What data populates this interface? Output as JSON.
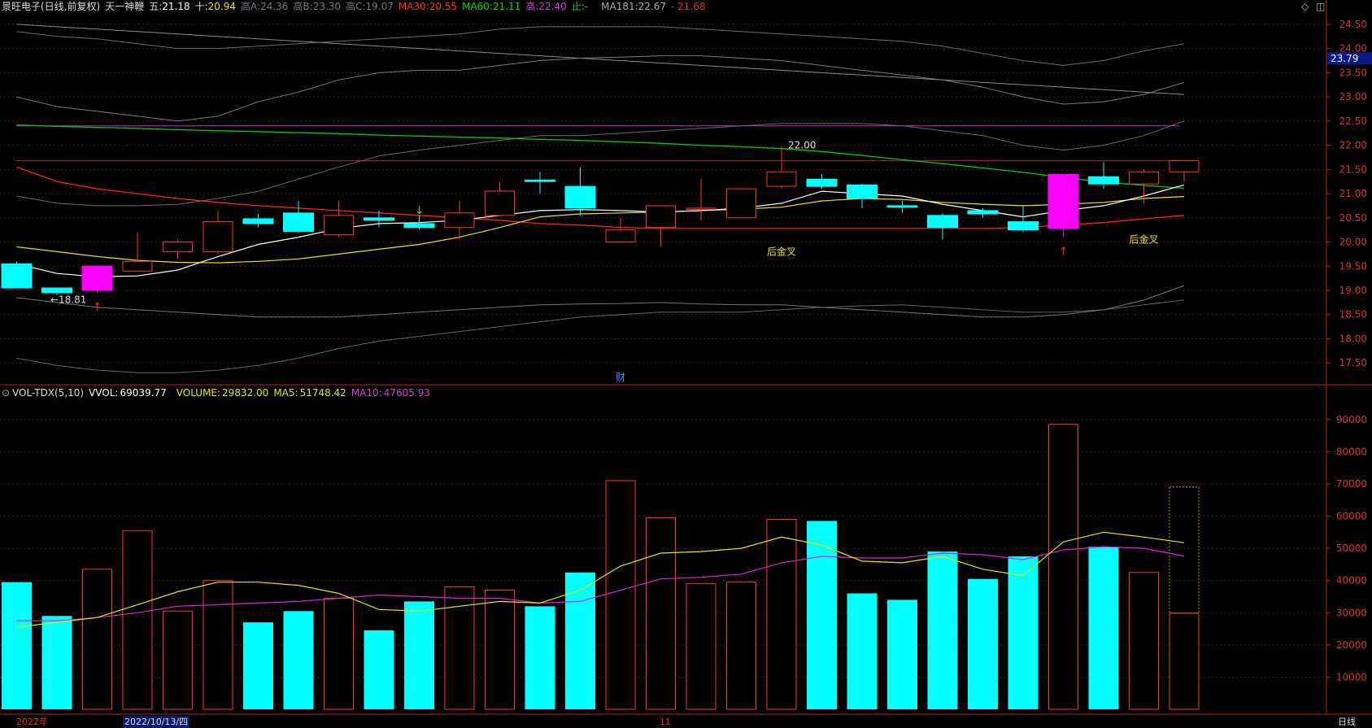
{
  "header": {
    "stock": "景旺电子(日线,前复权)",
    "indicator": "天一神鞭",
    "wu_label": "五:",
    "wu_val": "21.18",
    "shi_label": "十:",
    "shi_val": "20.94",
    "gaoA_label": "高A:",
    "gaoA_val": "24.36",
    "gaoB_label": "高B:",
    "gaoB_val": "23.30",
    "gaoC_label": "高C:",
    "gaoC_val": "19.07",
    "ma30_label": "MA30:",
    "ma30_val": "20.55",
    "ma60_label": "MA60:",
    "ma60_val": "21.11",
    "ya_label": "高:",
    "ya_val": "22.40",
    "zhi_label": "止:",
    "zhi_val": "-",
    "ma181_label": "MA181:",
    "ma181_val": "22.67",
    "last_val": "21.68"
  },
  "vol_header": {
    "name": "VOL-TDX(5,10)",
    "vvol_label": "VVOL:",
    "vvol_val": "69039.77",
    "volume_label": "VOLUME:",
    "volume_val": "29832.00",
    "ma5_label": "MA5:",
    "ma5_val": "51748.42",
    "ma10_label": "MA10:",
    "ma10_val": "47605.93"
  },
  "toolbar": {
    "diamond": "◇",
    "square": "◫"
  },
  "date_axis": {
    "year": "2022年",
    "cursor_date": "2022/10/13/四",
    "month": "11",
    "period": "日线"
  },
  "price_badge": "23.79",
  "chart_data": [
    {
      "type": "candlestick",
      "title": "景旺电子(日线,前复权)",
      "ylim": [
        17.1,
        24.7
      ],
      "y_ticks": [
        "24.50",
        "24.00",
        "23.50",
        "23.00",
        "22.50",
        "22.00",
        "21.50",
        "21.00",
        "20.50",
        "20.00",
        "19.50",
        "19.00",
        "18.50",
        "18.00",
        "17.50"
      ],
      "candles": [
        {
          "o": 19.55,
          "h": 19.6,
          "l": 19.05,
          "c": 19.05
        },
        {
          "o": 19.05,
          "h": 19.05,
          "l": 18.9,
          "c": 18.95
        },
        {
          "o": 19.0,
          "h": 19.5,
          "l": 18.95,
          "c": 19.5
        },
        {
          "o": 19.4,
          "h": 20.2,
          "l": 19.4,
          "c": 19.6
        },
        {
          "o": 19.8,
          "h": 20.05,
          "l": 19.65,
          "c": 20.0
        },
        {
          "o": 19.8,
          "h": 20.65,
          "l": 19.75,
          "c": 20.42
        },
        {
          "o": 20.48,
          "h": 20.58,
          "l": 20.3,
          "c": 20.38
        },
        {
          "o": 20.6,
          "h": 20.85,
          "l": 20.18,
          "c": 20.22
        },
        {
          "o": 20.15,
          "h": 20.85,
          "l": 20.1,
          "c": 20.55
        },
        {
          "o": 20.5,
          "h": 20.65,
          "l": 20.3,
          "c": 20.45
        },
        {
          "o": 20.38,
          "h": 20.55,
          "l": 20.25,
          "c": 20.3
        },
        {
          "o": 20.3,
          "h": 20.85,
          "l": 20.05,
          "c": 20.6
        },
        {
          "o": 20.55,
          "h": 21.25,
          "l": 20.55,
          "c": 21.05
        },
        {
          "o": 21.28,
          "h": 21.45,
          "l": 21.0,
          "c": 21.25
        },
        {
          "o": 21.15,
          "h": 21.55,
          "l": 20.55,
          "c": 20.7
        },
        {
          "o": 20.0,
          "h": 20.5,
          "l": 20.0,
          "c": 20.25
        },
        {
          "o": 20.3,
          "h": 20.75,
          "l": 19.9,
          "c": 20.75
        },
        {
          "o": 20.7,
          "h": 21.3,
          "l": 20.45,
          "c": 20.7
        },
        {
          "o": 20.5,
          "h": 21.1,
          "l": 20.5,
          "c": 21.1
        },
        {
          "o": 21.15,
          "h": 21.98,
          "l": 21.1,
          "c": 21.45
        },
        {
          "o": 21.3,
          "h": 21.4,
          "l": 21.1,
          "c": 21.15
        },
        {
          "o": 21.18,
          "h": 21.2,
          "l": 20.7,
          "c": 20.9
        },
        {
          "o": 20.75,
          "h": 20.85,
          "l": 20.6,
          "c": 20.72
        },
        {
          "o": 20.55,
          "h": 20.6,
          "l": 20.05,
          "c": 20.3
        },
        {
          "o": 20.65,
          "h": 20.7,
          "l": 20.5,
          "c": 20.58
        },
        {
          "o": 20.42,
          "h": 20.75,
          "l": 20.2,
          "c": 20.25
        },
        {
          "o": 20.28,
          "h": 21.4,
          "l": 20.1,
          "c": 21.4
        },
        {
          "o": 21.35,
          "h": 21.65,
          "l": 21.1,
          "c": 21.2
        },
        {
          "o": 21.2,
          "h": 21.5,
          "l": 20.8,
          "c": 21.45
        },
        {
          "o": 21.45,
          "h": 21.7,
          "l": 21.25,
          "c": 21.68
        }
      ],
      "wu_ma": [
        19.55,
        19.35,
        19.28,
        19.3,
        19.42,
        19.7,
        19.95,
        20.1,
        20.28,
        20.38,
        20.4,
        20.45,
        20.55,
        20.65,
        20.67,
        20.65,
        20.62,
        20.65,
        20.7,
        20.8,
        21.05,
        21.0,
        20.95,
        20.78,
        20.65,
        20.52,
        20.65,
        20.75,
        20.95,
        21.18
      ],
      "shi_ma": [
        19.9,
        19.8,
        19.7,
        19.62,
        19.58,
        19.57,
        19.6,
        19.65,
        19.75,
        19.85,
        19.95,
        20.1,
        20.3,
        20.52,
        20.58,
        20.6,
        20.62,
        20.65,
        20.68,
        20.72,
        20.85,
        20.9,
        20.88,
        20.82,
        20.78,
        20.75,
        20.78,
        20.82,
        20.9,
        20.94
      ],
      "ma30": [
        21.55,
        21.25,
        21.1,
        21.0,
        20.9,
        20.82,
        20.75,
        20.7,
        20.65,
        20.6,
        20.55,
        20.5,
        20.45,
        20.38,
        20.35,
        20.3,
        20.28,
        20.28,
        20.28,
        20.28,
        20.28,
        20.28,
        20.28,
        20.28,
        20.28,
        20.3,
        20.35,
        20.4,
        20.48,
        20.55
      ],
      "ma60": [
        22.42,
        22.39,
        22.37,
        22.35,
        22.32,
        22.3,
        22.28,
        22.26,
        22.24,
        22.21,
        22.19,
        22.17,
        22.15,
        22.12,
        22.1,
        22.07,
        22.04,
        22.0,
        21.97,
        21.93,
        21.87,
        21.79,
        21.7,
        21.62,
        21.53,
        21.44,
        21.33,
        21.24,
        21.17,
        21.11
      ],
      "resistance": 22.4,
      "ma181": [
        24.5,
        24.45,
        24.4,
        24.35,
        24.3,
        24.25,
        24.2,
        24.15,
        24.1,
        24.05,
        24.0,
        23.95,
        23.9,
        23.85,
        23.8,
        23.75,
        23.7,
        23.65,
        23.6,
        23.55,
        23.5,
        23.45,
        23.4,
        23.35,
        23.3,
        23.25,
        23.2,
        23.15,
        23.1,
        23.05
      ],
      "upper_band": [
        24.35,
        24.25,
        24.2,
        24.1,
        24.0,
        24.0,
        24.05,
        24.1,
        24.15,
        24.2,
        24.25,
        24.3,
        24.4,
        24.45,
        24.45,
        24.45,
        24.45,
        24.4,
        24.35,
        24.3,
        24.25,
        24.2,
        24.15,
        24.05,
        23.9,
        23.75,
        23.65,
        23.75,
        23.95,
        24.1
      ],
      "upper_mid": [
        23.0,
        22.8,
        22.7,
        22.6,
        22.5,
        22.6,
        22.9,
        23.1,
        23.35,
        23.5,
        23.55,
        23.55,
        23.65,
        23.75,
        23.8,
        23.82,
        23.85,
        23.85,
        23.8,
        23.75,
        23.65,
        23.55,
        23.45,
        23.35,
        23.2,
        23.0,
        22.85,
        22.9,
        23.05,
        23.3
      ],
      "lower_mid": [
        20.95,
        20.8,
        20.75,
        20.75,
        20.78,
        20.9,
        21.05,
        21.3,
        21.55,
        21.78,
        21.9,
        22.0,
        22.1,
        22.2,
        22.2,
        22.25,
        22.3,
        22.35,
        22.4,
        22.45,
        22.45,
        22.45,
        22.4,
        22.3,
        22.2,
        22.0,
        21.9,
        22.0,
        22.2,
        22.5
      ],
      "gaoC_line": [
        18.85,
        18.75,
        18.65,
        18.6,
        18.55,
        18.5,
        18.45,
        18.45,
        18.45,
        18.5,
        18.55,
        18.6,
        18.65,
        18.7,
        18.72,
        18.73,
        18.75,
        18.72,
        18.7,
        18.7,
        18.65,
        18.6,
        18.55,
        18.5,
        18.45,
        18.45,
        18.5,
        18.6,
        18.8,
        19.1
      ],
      "lower_band": [
        17.6,
        17.45,
        17.35,
        17.3,
        17.3,
        17.35,
        17.45,
        17.6,
        17.8,
        17.95,
        18.05,
        18.15,
        18.25,
        18.35,
        18.45,
        18.5,
        18.55,
        18.55,
        18.55,
        18.6,
        18.65,
        18.68,
        18.7,
        18.65,
        18.6,
        18.55,
        18.55,
        18.6,
        18.7,
        18.8
      ],
      "annotations": [
        {
          "text": "←18.81",
          "index": 1,
          "price": 18.81
        },
        {
          "text": "22.00",
          "index": 19,
          "price": 22.0
        },
        {
          "text": "后金叉",
          "index": 19,
          "price": 19.8
        },
        {
          "text": "后金叉",
          "index": 28,
          "price": 20.05
        },
        {
          "text": "财",
          "index": 15,
          "price": 17.2
        }
      ],
      "up_arrows": [
        2,
        26
      ],
      "down_arrows": [
        10
      ]
    },
    {
      "type": "bar",
      "title": "VOL-TDX(5,10)",
      "ylim": [
        0,
        95000
      ],
      "y_ticks": [
        "90000",
        "80000",
        "70000",
        "60000",
        "50000",
        "40000",
        "30000",
        "20000",
        "10000"
      ],
      "volumes": [
        39500,
        29000,
        43500,
        55500,
        30500,
        40000,
        27000,
        30500,
        34500,
        24500,
        33500,
        38000,
        37000,
        32000,
        42500,
        71000,
        59500,
        39000,
        39500,
        59000,
        58500,
        36000,
        34000,
        49000,
        40500,
        47500,
        88500,
        50500,
        42500,
        29832
      ],
      "up": [
        false,
        false,
        true,
        true,
        true,
        true,
        false,
        false,
        true,
        false,
        false,
        true,
        true,
        false,
        false,
        true,
        true,
        true,
        true,
        true,
        false,
        false,
        false,
        false,
        false,
        false,
        true,
        false,
        true,
        true
      ],
      "vvol": 69039.77,
      "ma5": [
        25500,
        27000,
        28500,
        32500,
        36500,
        39500,
        39500,
        38500,
        36000,
        31000,
        30500,
        32000,
        33500,
        33000,
        37000,
        44500,
        48500,
        49000,
        50000,
        53500,
        51000,
        46000,
        45500,
        47500,
        43500,
        41500,
        52000,
        55000,
        53500,
        51748.42
      ],
      "ma10": [
        27500,
        27500,
        28500,
        30000,
        32000,
        32500,
        33000,
        33500,
        34500,
        35500,
        35000,
        34500,
        34500,
        33000,
        33500,
        37000,
        40500,
        41000,
        42000,
        45500,
        47500,
        47000,
        47000,
        48500,
        48000,
        46500,
        49500,
        50500,
        50000,
        47605.93
      ]
    }
  ]
}
